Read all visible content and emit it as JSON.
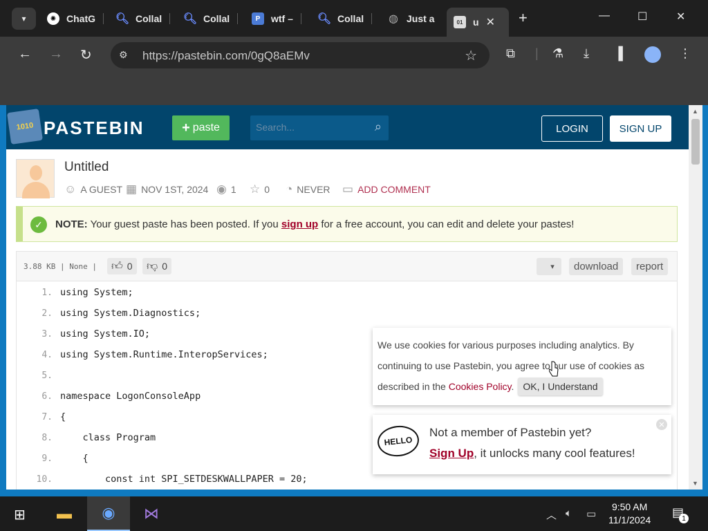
{
  "browser": {
    "tabs": [
      {
        "label": "ChatG",
        "icon": "chatgpt-icon"
      },
      {
        "label": "Collal",
        "icon": "search-icon"
      },
      {
        "label": "Collal",
        "icon": "search-icon"
      },
      {
        "label": "wtf –",
        "icon": "pastebin-p-icon"
      },
      {
        "label": "Collal",
        "icon": "search-icon"
      },
      {
        "label": "Just a",
        "icon": "globe-icon"
      },
      {
        "label": "u",
        "icon": "pastebin-icon",
        "active": true
      }
    ],
    "new_tab": "+",
    "url": "https://pastebin.com/0gQ8aEMv"
  },
  "site": {
    "brand": "PASTEBIN",
    "paste_button": "paste",
    "search_placeholder": "Search...",
    "login": "LOGIN",
    "signup": "SIGN UP"
  },
  "paste": {
    "title": "Untitled",
    "author": "A GUEST",
    "date": "NOV 1ST, 2024",
    "views": "1",
    "stars": "0",
    "expiry": "NEVER",
    "add_comment": "ADD COMMENT"
  },
  "notice": {
    "label": "NOTE:",
    "text_before": " Your guest paste has been posted. If you ",
    "link": "sign up",
    "text_after": " for a free account, you can edit and delete your pastes!"
  },
  "code_bar": {
    "info": "3.88 KB | None |",
    "likes": "0",
    "dislikes": "0",
    "download": "download",
    "report": "report"
  },
  "code": [
    {
      "num": "1.",
      "text": "using System;"
    },
    {
      "num": "2.",
      "text": "using System.Diagnostics;"
    },
    {
      "num": "3.",
      "text": "using System.IO;"
    },
    {
      "num": "4.",
      "text": "using System.Runtime.InteropServices;"
    },
    {
      "num": "5.",
      "text": ""
    },
    {
      "num": "6.",
      "text": "namespace LogonConsoleApp"
    },
    {
      "num": "7.",
      "text": "{"
    },
    {
      "num": "8.",
      "text": "    class Program"
    },
    {
      "num": "9.",
      "text": "    {"
    },
    {
      "num": "10.",
      "text": "        const int SPI_SETDESKWALLPAPER = 20;"
    }
  ],
  "cookie": {
    "text": "We use cookies for various purposes including analytics. By continuing to use Pastebin, you agree to our use of cookies as described in the ",
    "link": "Cookies Policy",
    "period": ".",
    "ok": "OK, I Understand"
  },
  "member": {
    "badge": "HELLO",
    "line1": "Not a member of Pastebin yet?",
    "link": "Sign Up",
    "line2": ", it unlocks many cool features!"
  },
  "taskbar": {
    "time": "9:50 AM",
    "date": "11/1/2024",
    "notifications": "1"
  },
  "colors": {
    "header": "#02456c",
    "paste_green": "#52b85c",
    "link_red": "#a00028"
  }
}
